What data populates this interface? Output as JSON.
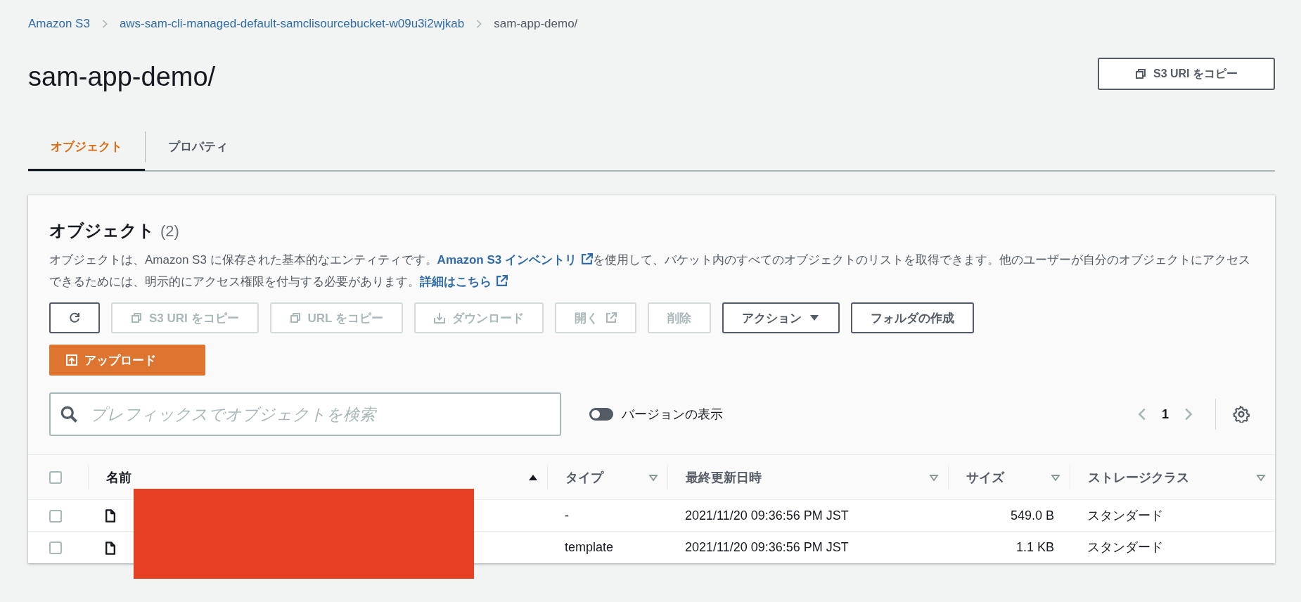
{
  "breadcrumb": [
    {
      "label": "Amazon S3",
      "link": true
    },
    {
      "label": "aws-sam-cli-managed-default-samclisourcebucket-w09u3i2wjkab",
      "link": true
    },
    {
      "label": "sam-app-demo/",
      "link": false
    }
  ],
  "title": "sam-app-demo/",
  "header_button": {
    "label": "S3 URI をコピー",
    "kind": "copy"
  },
  "tabs": [
    {
      "label": "オブジェクト",
      "selected": true
    },
    {
      "label": "プロパティ",
      "selected": false
    }
  ],
  "panel": {
    "heading": "オブジェクト",
    "count": "(2)",
    "description": [
      {
        "kind": "text",
        "text": "オブジェクトは、Amazon S3 に保存された基本的なエンティティです。"
      },
      {
        "kind": "link",
        "text": "Amazon S3 インベントリ"
      },
      {
        "kind": "text",
        "text": "を使用して、バケット内のすべてのオブジェクトのリストを取得できます。他のユーザーが自分のオブジェクトにアクセスできるためには、明示的にアクセス権限を付与する必要があります。"
      },
      {
        "kind": "link",
        "text": "詳細はこちら"
      }
    ],
    "buttons": [
      {
        "disabled": false,
        "kind": "refresh"
      },
      {
        "label": "S3 URI をコピー",
        "disabled": true,
        "kind": "copy"
      },
      {
        "label": "URL をコピー",
        "disabled": true,
        "kind": "copy"
      },
      {
        "label": "ダウンロード",
        "disabled": true,
        "kind": "download"
      },
      {
        "label": "開く",
        "disabled": true,
        "kind": "open"
      },
      {
        "label": "削除",
        "disabled": true,
        "kind": "plain"
      },
      {
        "label": "アクション",
        "disabled": false,
        "kind": "menu"
      },
      {
        "label": "フォルダの作成",
        "disabled": false,
        "kind": "plain"
      },
      {
        "label": "アップロード",
        "disabled": false,
        "kind": "upload"
      }
    ],
    "search": {
      "placeholder": "プレフィックスでオブジェクトを検索"
    },
    "version_toggle": {
      "label": "バージョンの表示",
      "on": false
    },
    "pagination": {
      "page": "1"
    },
    "table": {
      "all_checked": false,
      "columns": [
        {
          "label": "名前",
          "sorted": true
        },
        {
          "label": "タイプ",
          "sorted": false
        },
        {
          "label": "最終更新日時",
          "sorted": false
        },
        {
          "label": "サイズ",
          "sorted": false
        },
        {
          "label": "ストレージクラス",
          "sorted": false
        }
      ],
      "rows": [
        {
          "checked": false,
          "type": "-",
          "modified": "2021/11/20 09:36:56 PM JST",
          "size": "549.0 B",
          "storage": "スタンダード"
        },
        {
          "checked": false,
          "type": "template",
          "modified": "2021/11/20 09:36:56 PM JST",
          "size": "1.1 KB",
          "storage": "スタンダード"
        }
      ],
      "names_redacted": true
    }
  }
}
